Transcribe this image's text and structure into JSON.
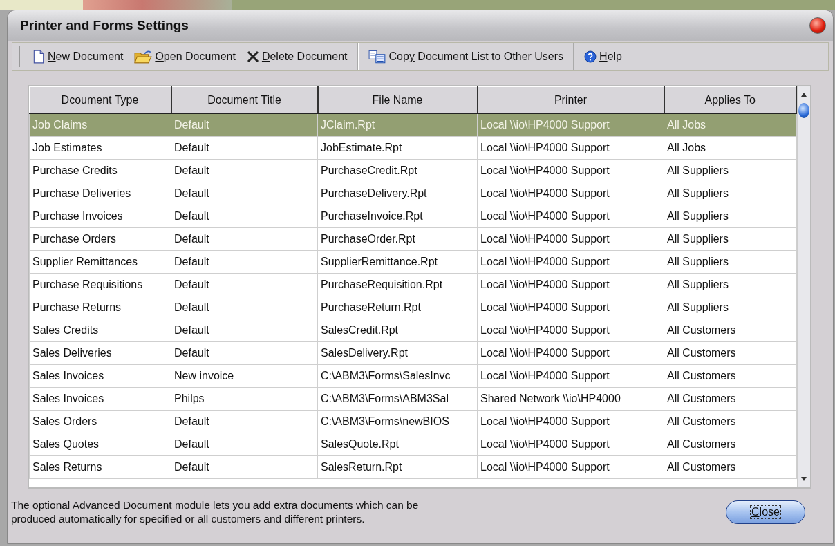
{
  "window": {
    "title": "Printer and Forms Settings"
  },
  "toolbar": [
    {
      "kind": "new",
      "key": "N",
      "post": "ew Document"
    },
    {
      "kind": "open",
      "key": "O",
      "post": "pen Document"
    },
    {
      "kind": "delete",
      "key": "D",
      "post": "elete Document"
    },
    {
      "kind": "copy",
      "pre": "Cop",
      "key": "y",
      "post": " Document List to Other Users"
    },
    {
      "kind": "help",
      "key": "H",
      "post": "elp"
    }
  ],
  "table": {
    "columns": [
      "Dcoument Type",
      "Document Title",
      "File Name",
      "Printer",
      "Applies To"
    ],
    "rows": [
      {
        "selected": true,
        "cells": [
          "Job Claims",
          "Default",
          "JClaim.Rpt",
          "Local \\\\io\\HP4000 Support",
          "All Jobs"
        ]
      },
      {
        "selected": false,
        "cells": [
          "Job Estimates",
          "Default",
          "JobEstimate.Rpt",
          "Local \\\\io\\HP4000 Support",
          "All Jobs"
        ]
      },
      {
        "selected": false,
        "cells": [
          "Purchase Credits",
          "Default",
          "PurchaseCredit.Rpt",
          "Local \\\\io\\HP4000 Support",
          "All Suppliers"
        ]
      },
      {
        "selected": false,
        "cells": [
          "Purchase Deliveries",
          "Default",
          "PurchaseDelivery.Rpt",
          "Local \\\\io\\HP4000 Support",
          "All Suppliers"
        ]
      },
      {
        "selected": false,
        "cells": [
          "Purchase Invoices",
          "Default",
          "PurchaseInvoice.Rpt",
          "Local \\\\io\\HP4000 Support",
          "All Suppliers"
        ]
      },
      {
        "selected": false,
        "cells": [
          "Purchase Orders",
          "Default",
          "PurchaseOrder.Rpt",
          "Local \\\\io\\HP4000 Support",
          "All Suppliers"
        ]
      },
      {
        "selected": false,
        "cells": [
          "Supplier Remittances",
          "Default",
          "SupplierRemittance.Rpt",
          "Local \\\\io\\HP4000 Support",
          "All Suppliers"
        ]
      },
      {
        "selected": false,
        "cells": [
          "Purchase Requisitions",
          "Default",
          "PurchaseRequisition.Rpt",
          "Local \\\\io\\HP4000 Support",
          "All Suppliers"
        ]
      },
      {
        "selected": false,
        "cells": [
          "Purchase Returns",
          "Default",
          "PurchaseReturn.Rpt",
          "Local \\\\io\\HP4000 Support",
          "All Suppliers"
        ]
      },
      {
        "selected": false,
        "cells": [
          "Sales Credits",
          "Default",
          "SalesCredit.Rpt",
          "Local \\\\io\\HP4000 Support",
          "All Customers"
        ]
      },
      {
        "selected": false,
        "cells": [
          "Sales Deliveries",
          "Default",
          "SalesDelivery.Rpt",
          "Local \\\\io\\HP4000 Support",
          "All Customers"
        ]
      },
      {
        "selected": false,
        "cells": [
          "Sales Invoices",
          "New invoice",
          "C:\\ABM3\\Forms\\SalesInvc",
          "Local \\\\io\\HP4000 Support",
          "All Customers"
        ]
      },
      {
        "selected": false,
        "cells": [
          "Sales Invoices",
          "Philps",
          "C:\\ABM3\\Forms\\ABM3Sal",
          "Shared Network \\\\io\\HP4000",
          "All Customers"
        ]
      },
      {
        "selected": false,
        "cells": [
          "Sales Orders",
          "Default",
          "C:\\ABM3\\Forms\\newBIOS",
          "Local \\\\io\\HP4000 Support",
          "All Customers"
        ]
      },
      {
        "selected": false,
        "cells": [
          "Sales Quotes",
          "Default",
          "SalesQuote.Rpt",
          "Local \\\\io\\HP4000 Support",
          "All Customers"
        ]
      },
      {
        "selected": false,
        "cells": [
          "Sales Returns",
          "Default",
          "SalesReturn.Rpt",
          "Local \\\\io\\HP4000 Support",
          "All Customers"
        ]
      }
    ]
  },
  "footer": {
    "note": "The optional Advanced Document module lets you add extra documents which can be produced automatically for specified or all customers and different printers.",
    "close_button": {
      "key": "C",
      "post": "lose"
    }
  }
}
